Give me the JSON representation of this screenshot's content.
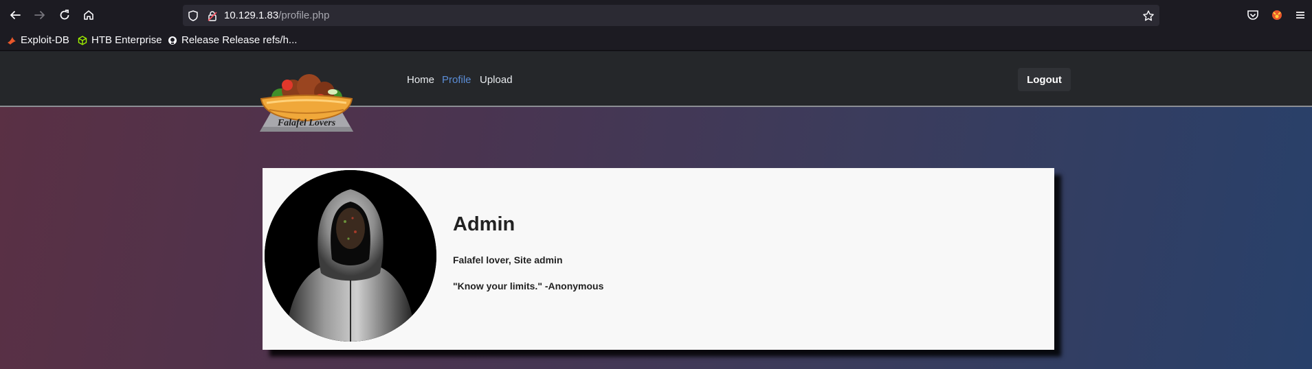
{
  "browser": {
    "url_host": "10.129.1.83",
    "url_path": "/profile.php",
    "bookmarks": [
      {
        "label": "Exploit-DB",
        "icon": "exploit-db-icon"
      },
      {
        "label": "HTB Enterprise",
        "icon": "htb-cube-icon"
      },
      {
        "label": "Release Release refs/h...",
        "icon": "github-icon"
      }
    ]
  },
  "site": {
    "logo_text": "Falafel Lovers",
    "nav": {
      "home": "Home",
      "profile": "Profile",
      "upload": "Upload",
      "logout": "Logout"
    }
  },
  "profile": {
    "name": "Admin",
    "role": "Falafel lover, Site admin",
    "quote": "\"Know your limits.\" -Anonymous"
  },
  "colors": {
    "active_nav": "#5b8dd6",
    "navbar_bg": "#25272a",
    "card_bg": "#f8f8f8"
  }
}
